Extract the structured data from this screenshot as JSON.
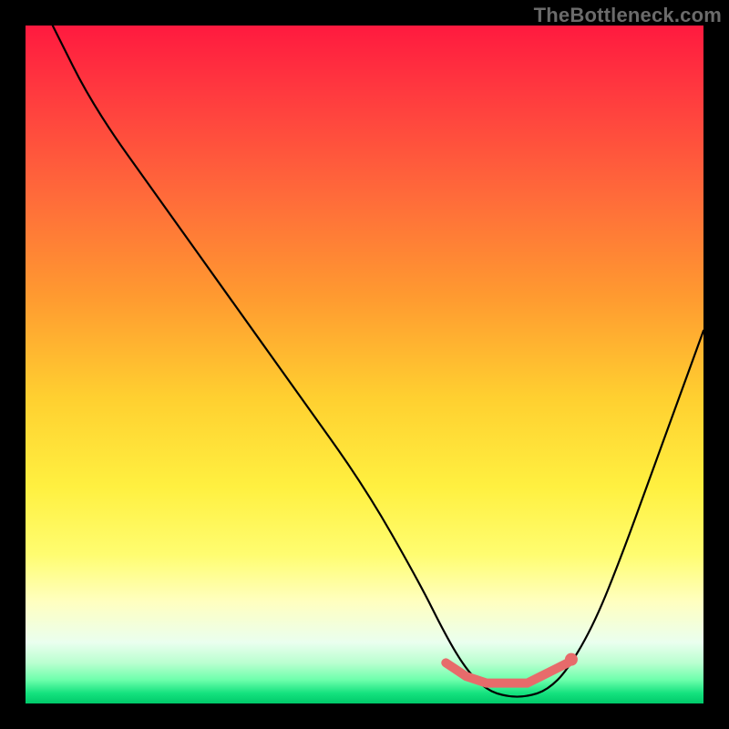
{
  "watermark": "TheBottleneck.com",
  "chart_data": {
    "type": "line",
    "title": "",
    "xlabel": "",
    "ylabel": "",
    "xlim": [
      0,
      100
    ],
    "ylim": [
      0,
      100
    ],
    "series": [
      {
        "name": "bottleneck-curve",
        "x": [
          4,
          10,
          20,
          30,
          40,
          50,
          58,
          62,
          65,
          68,
          71,
          74,
          77,
          80,
          84,
          88,
          92,
          96,
          100
        ],
        "y": [
          100,
          88,
          74,
          60,
          46,
          32,
          18,
          10,
          5,
          2,
          1,
          1,
          2,
          5,
          12,
          22,
          33,
          44,
          55
        ]
      }
    ],
    "annotations": [
      {
        "name": "bottom-pink-segment",
        "x": [
          62,
          65,
          68,
          70,
          72,
          74,
          76,
          78,
          80
        ],
        "y": [
          6,
          4,
          3,
          3,
          3,
          3,
          4,
          5,
          6
        ],
        "color": "#e76b6b"
      },
      {
        "name": "end-dot",
        "x": 80.5,
        "y": 6.5,
        "color": "#e76b6b"
      }
    ],
    "colors": {
      "curve": "#000000",
      "segment": "#e76b6b",
      "background_top": "#ff1a3f",
      "background_bottom": "#00c96a",
      "frame": "#000000",
      "watermark": "#6b6b6b"
    }
  }
}
